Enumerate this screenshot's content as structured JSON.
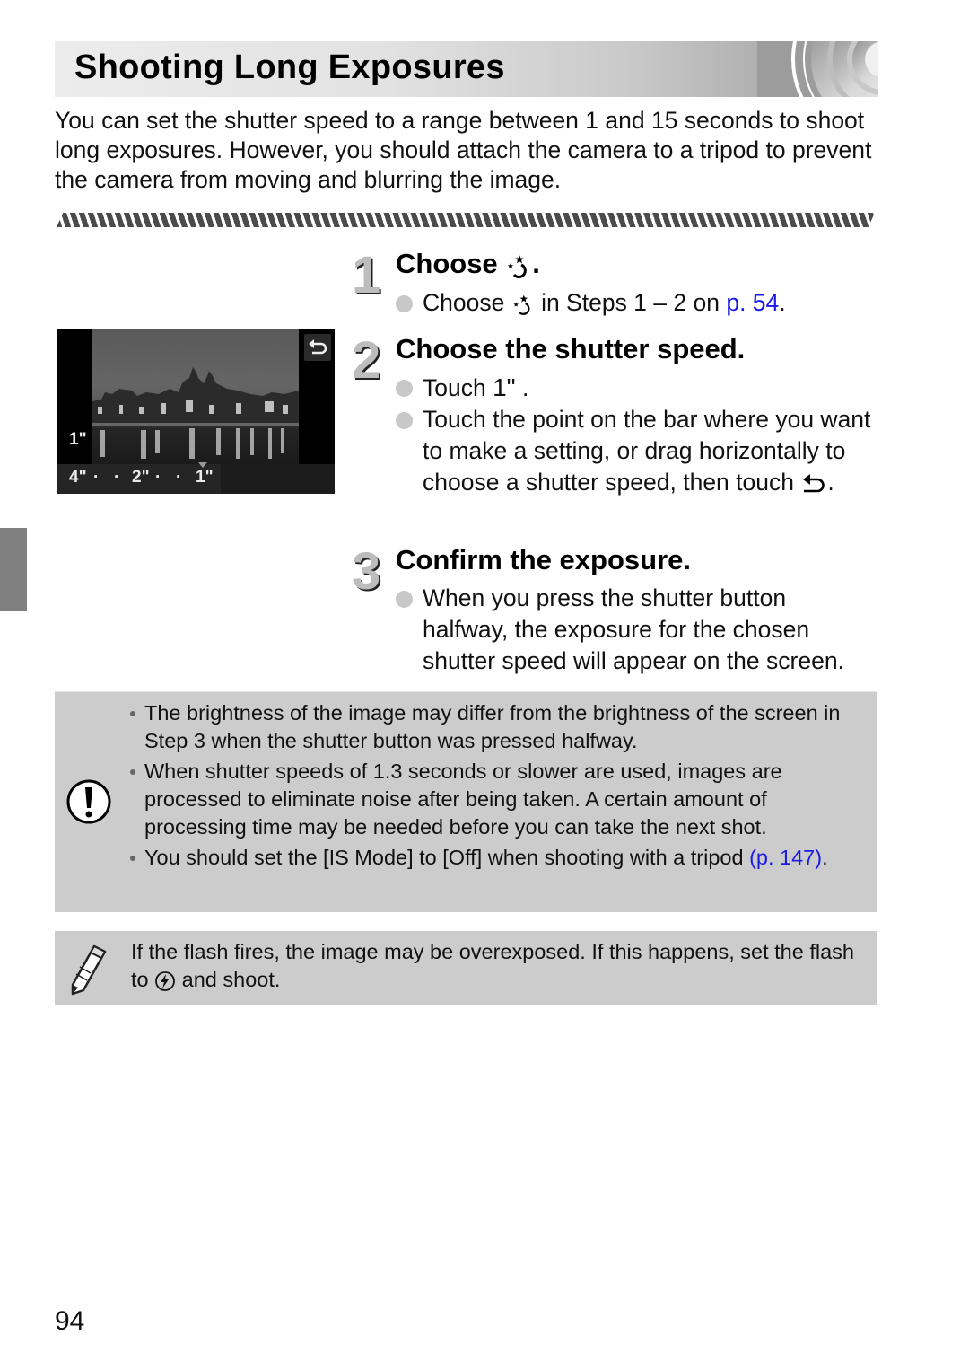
{
  "header": {
    "title": "Shooting Long Exposures"
  },
  "intro": "You can set the shutter speed to a range between 1 and 15 seconds to shoot long exposures. However, you should attach the camera to a tripod to prevent the camera from moving and blurring the image.",
  "steps": [
    {
      "number": "1",
      "title_prefix": "Choose ",
      "title_icon": "night-scene-mode-icon",
      "title_suffix": ".",
      "bullets": [
        {
          "pre": "Choose ",
          "icon": "night-scene-mode-icon",
          "mid": " in Steps 1 – 2 on ",
          "link": "p. 54",
          "post": "."
        }
      ]
    },
    {
      "number": "2",
      "title": "Choose the shutter speed.",
      "bullets": [
        {
          "pre": "Touch ",
          "value": "1\"",
          "post": " ."
        },
        {
          "pre": "Touch the point on the bar where you want to make a setting, or drag horizontally to choose a shutter speed, then touch ",
          "icon": "return-icon",
          "post": "."
        }
      ]
    },
    {
      "number": "3",
      "title": "Confirm the exposure.",
      "bullets": [
        {
          "text": "When you press the shutter button halfway, the exposure for the chosen shutter speed will appear on the screen."
        }
      ]
    }
  ],
  "camera_screen": {
    "current_value": "1\"",
    "scale_labels": [
      "4\"",
      "2\"",
      "1\""
    ],
    "back_icon": "return-icon"
  },
  "caution": {
    "icon": "caution-icon",
    "items": [
      {
        "text": "The brightness of the image may differ from the brightness of the screen in Step 3 when the shutter button was pressed halfway."
      },
      {
        "text": "When shutter speeds of 1.3 seconds or slower are used, images are processed to eliminate noise after being taken. A certain amount of processing time may be needed before you can take the next shot."
      },
      {
        "text": "You should set the [IS Mode] to [Off] when shooting with a tripod ",
        "link": "(p. 147)",
        "post": "."
      }
    ]
  },
  "note": {
    "icon": "pencil-icon",
    "pre": "If the flash fires, the image may be overexposed. If this happens, set the flash to ",
    "flash_icon": "flash-off-icon",
    "post": " and shoot."
  },
  "page_number": "94",
  "colors": {
    "link": "#1a1ae6",
    "box_bg": "#cccccc",
    "sidebar_tab": "#808080"
  }
}
